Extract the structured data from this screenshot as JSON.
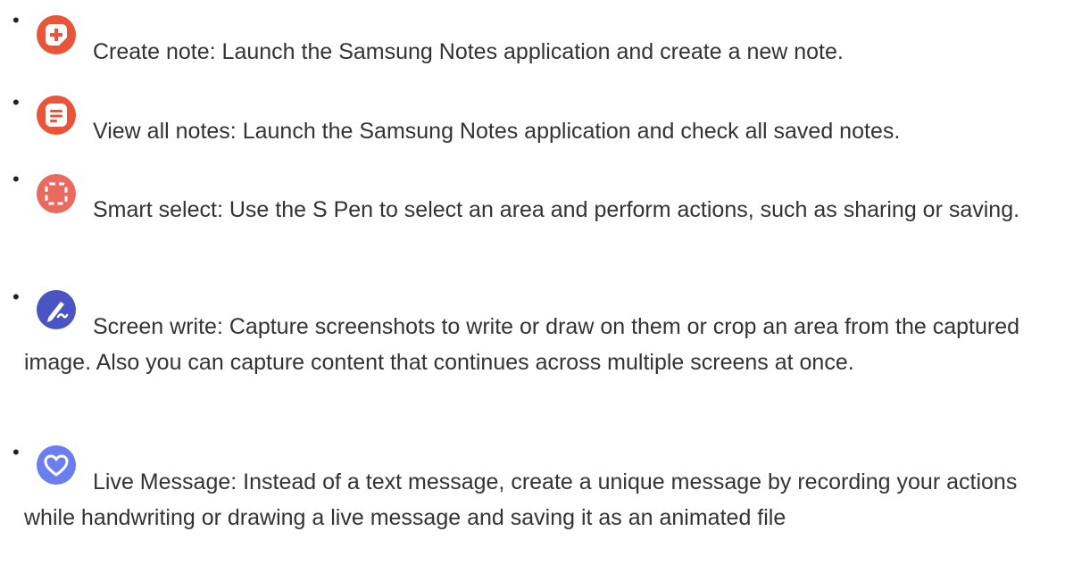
{
  "features": [
    {
      "name": "Create note",
      "description": "Launch the Samsung Notes application and create a new note.",
      "icon": "create-note-icon",
      "color": "#e8553a"
    },
    {
      "name": "View all notes",
      "description": "Launch the Samsung Notes application and check all saved notes.",
      "icon": "view-notes-icon",
      "color": "#e8553a"
    },
    {
      "name": "Smart select",
      "description": "Use the S Pen to select an area and perform actions, such as sharing or saving.",
      "icon": "smart-select-icon",
      "color": "#e96a5e"
    },
    {
      "name": "Screen write",
      "description": "Capture screenshots to write or draw on them or crop an area from the captured image. Also you can capture content that continues across multiple screens at once.",
      "icon": "screen-write-icon",
      "color": "#4a55c4"
    },
    {
      "name": "Live Message",
      "description": "Instead of a text message, create a unique message by recording your actions while handwriting or drawing a live message and saving it as an animated file",
      "icon": "live-message-icon",
      "color": "#6b7ef0"
    }
  ],
  "separator": ": ",
  "bullet_char": "•"
}
